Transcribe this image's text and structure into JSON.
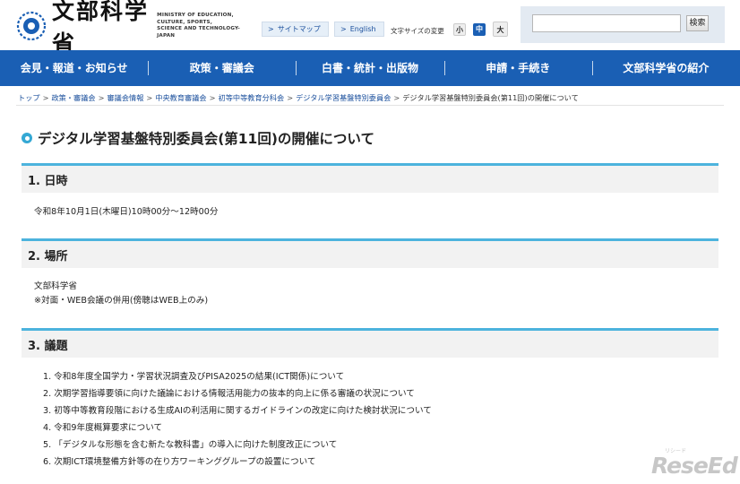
{
  "header": {
    "logo_text": "文部科学省",
    "logo_sub": [
      "MINISTRY OF EDUCATION,",
      "CULTURE, SPORTS,",
      "SCIENCE AND TECHNOLOGY-JAPAN"
    ],
    "sitemap_label": "サイトマップ",
    "english_label": "English",
    "fontsize_label": "文字サイズの変更",
    "fontsize_small": "小",
    "fontsize_medium": "中",
    "fontsize_large": "大",
    "search_placeholder": "",
    "search_button": "検索"
  },
  "nav": {
    "items": [
      "会見・報道・お知らせ",
      "政策・審議会",
      "白書・統計・出版物",
      "申請・手続き",
      "文部科学省の紹介"
    ]
  },
  "breadcrumb": {
    "links": [
      "トップ",
      "政策・審議会",
      "審議会情報",
      "中央教育審議会",
      "初等中等教育分科会",
      "デジタル学習基盤特別委員会"
    ],
    "current": "デジタル学習基盤特別委員会(第11回)の開催について",
    "separator": ">"
  },
  "page": {
    "title": "デジタル学習基盤特別委員会(第11回)の開催について"
  },
  "sections": {
    "datetime": {
      "heading": "1. 日時",
      "body": "令和8年10月1日(木曜日)10時00分～12時00分"
    },
    "place": {
      "heading": "2. 場所",
      "line1": "文部科学省",
      "line2": "※対面・WEB会議の併用(傍聴はWEB上のみ)"
    },
    "agenda": {
      "heading": "3. 議題",
      "items": [
        "1. 令和8年度全国学力・学習状況調査及びPISA2025の結果(ICT関係)について",
        "2. 次期学習指導要領に向けた議論における情報活用能力の抜本的向上に係る審議の状況について",
        "3. 初等中等教育段階における生成AIの利活用に関するガイドラインの改定に向けた検討状況について",
        "4. 令和9年度概算要求について",
        "5. 「デジタルな形態を含む新たな教科書」の導入に向けた制度改正について",
        "6. 次期ICT環境整備方針等の在り方ワーキンググループの設置について"
      ]
    }
  },
  "watermark": {
    "text": "ReseEd",
    "small": "リシード"
  },
  "colors": {
    "nav_bg": "#1a5fb4",
    "accent": "#4cb3dd",
    "link": "#1a4f9c"
  }
}
